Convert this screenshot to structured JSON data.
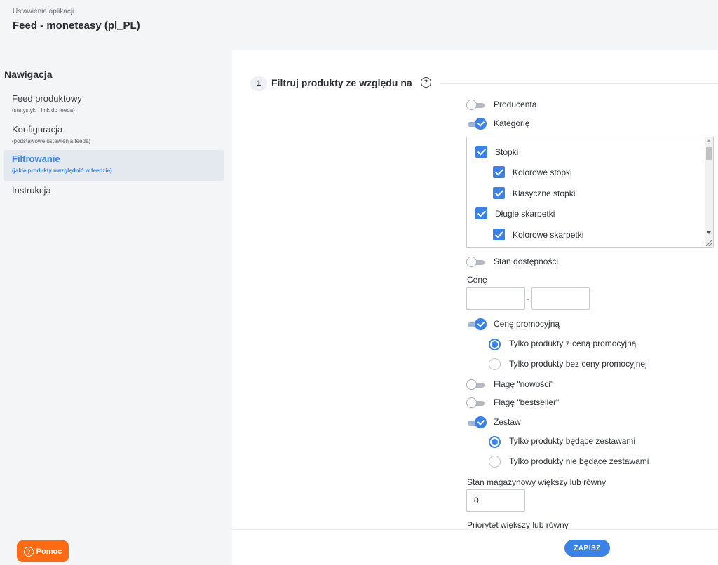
{
  "header": {
    "subtitle": "Ustawienia aplikacji",
    "title": "Feed - moneteasy (pl_PL)"
  },
  "nav": {
    "heading": "Nawigacja",
    "items": [
      {
        "label": "Feed produktowy",
        "sub": "(statystyki i link do feeda)"
      },
      {
        "label": "Konfiguracja",
        "sub": "(podstawowe ustawienia feeda)"
      },
      {
        "label": "Filtrowanie",
        "sub": "(jakie produkty uwzględnić w feedzie)"
      },
      {
        "label": "Instrukcja",
        "sub": ""
      }
    ],
    "active_item": "Filtrowanie"
  },
  "help": {
    "icon": "question-circle-icon",
    "label": "Pomoc"
  },
  "section": {
    "number": "1",
    "title": "Filtruj produkty ze względu na",
    "help_icon": "question-circle-icon"
  },
  "filters": {
    "producer": {
      "label": "Producenta",
      "on": false
    },
    "category": {
      "label": "Kategorię",
      "on": true,
      "tree": [
        {
          "label": "Stopki",
          "checked": true
        },
        {
          "label": "Kolorowe stopki",
          "checked": true
        },
        {
          "label": "Klasyczne stopki",
          "checked": true
        },
        {
          "label": "Długie skarpetki",
          "checked": true
        },
        {
          "label": "Kolorowe skarpetki",
          "checked": true
        }
      ]
    },
    "availability": {
      "label": "Stan dostępności",
      "on": false
    },
    "price": {
      "label": "Cenę",
      "from": "",
      "to": "",
      "separator": "-"
    },
    "promo_price": {
      "label": "Cenę promocyjną",
      "on": true,
      "options": [
        "Tylko produkty z ceną promocyjną",
        "Tylko produkty bez ceny promocyjnej"
      ],
      "selected": "Tylko produkty z ceną promocyjną"
    },
    "new_flag": {
      "label": "Flagę \"nowości\"",
      "on": false
    },
    "bestseller_flag": {
      "label": "Flagę \"bestseller\"",
      "on": false
    },
    "bundle": {
      "label": "Zestaw",
      "on": true,
      "options": [
        "Tylko produkty będące zestawami",
        "Tylko produkty nie będące zestawami"
      ],
      "selected": "Tylko produkty będące zestawami"
    },
    "stock": {
      "label": "Stan magazynowy większy lub równy",
      "value": "0"
    },
    "priority": {
      "label": "Priorytet większy lub równy"
    }
  },
  "footer": {
    "save_label": "ZAPISZ"
  },
  "colors": {
    "accent": "#3b82e6",
    "help_button": "#ff6a13"
  }
}
